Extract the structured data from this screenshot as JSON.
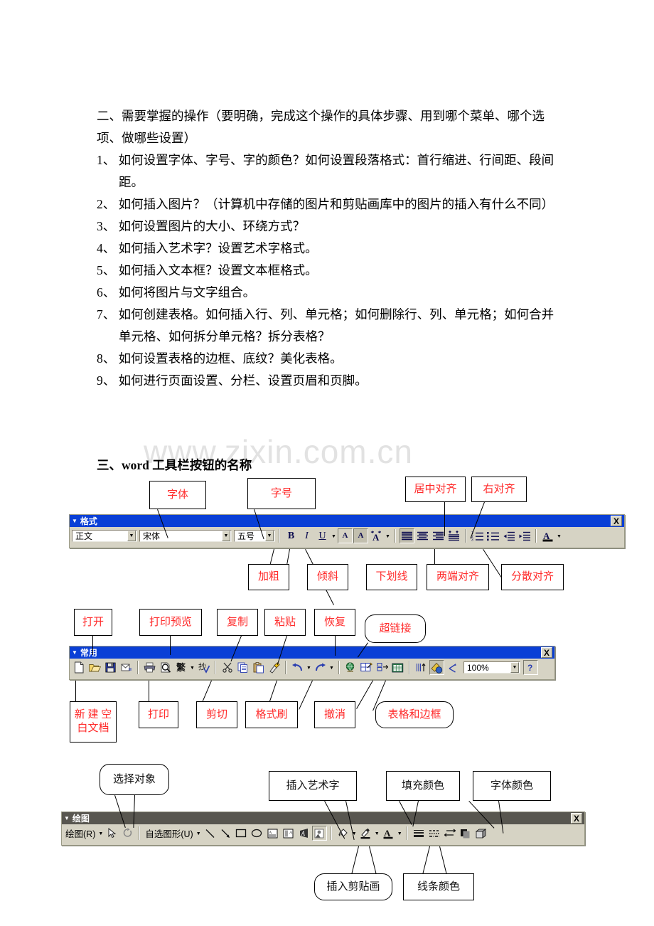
{
  "document": {
    "section_two_heading": "二、需要掌握的操作（要明确，完成这个操作的具体步骤、用到哪个菜单、哪个选项、做哪些设置）",
    "items": [
      "1、 如何设置字体、字号、字的颜色？如何设置段落格式：首行缩进、行间距、段间距。",
      "2、 如何插入图片？（计算机中存储的图片和剪贴画库中的图片的插入有什么不同）",
      "3、 如何设置图片的大小、环绕方式？",
      "4、 如何插入艺术字？设置艺术字格式。",
      "5、 如何插入文本框？设置文本框格式。",
      "6、 如何将图片与文字组合。",
      "7、 如何创建表格。如何插入行、列、单元格；如何删除行、列、单元格；如何合并单元格、如何拆分单元格？拆分表格？",
      "8、 如何设置表格的边框、底纹？美化表格。",
      "9、 如何进行页面设置、分栏、设置页眉和页脚。"
    ],
    "section_three_heading": "三、word 工具栏按钮的名称",
    "watermark": "www.zixin.com.cn"
  },
  "format_toolbar": {
    "title": "格式",
    "close_label": "X",
    "style_combo": "正文",
    "font_combo": "宋体",
    "size_combo": "五号",
    "buttons": [
      {
        "name": "bold",
        "glyph": "B"
      },
      {
        "name": "italic",
        "glyph": "I"
      },
      {
        "name": "underline",
        "glyph": "U"
      },
      {
        "name": "border-char",
        "glyph": "A"
      },
      {
        "name": "highlight-char",
        "glyph": "A"
      },
      {
        "name": "char-scaling",
        "glyph": "A"
      },
      {
        "name": "align-left"
      },
      {
        "name": "align-center"
      },
      {
        "name": "align-right"
      },
      {
        "name": "align-distributed"
      },
      {
        "name": "numbered-list"
      },
      {
        "name": "bulleted-list"
      },
      {
        "name": "decrease-indent"
      },
      {
        "name": "increase-indent"
      },
      {
        "name": "font-color",
        "glyph": "A"
      }
    ],
    "annotations": [
      {
        "id": "font-name",
        "label": "字体"
      },
      {
        "id": "font-size",
        "label": "字号"
      },
      {
        "id": "align-center",
        "label": "居中对齐"
      },
      {
        "id": "align-right",
        "label": "右对齐"
      },
      {
        "id": "bold",
        "label": "加粗"
      },
      {
        "id": "italic",
        "label": "倾斜"
      },
      {
        "id": "underline",
        "label": "下划线"
      },
      {
        "id": "justify",
        "label": "两端对齐"
      },
      {
        "id": "distributed",
        "label": "分散对齐"
      }
    ]
  },
  "standard_toolbar": {
    "title": "常用",
    "close_label": "X",
    "zoom_value": "100%",
    "annotations": [
      {
        "id": "open",
        "label": "打开"
      },
      {
        "id": "print-preview",
        "label": "打印预览"
      },
      {
        "id": "copy",
        "label": "复制"
      },
      {
        "id": "paste",
        "label": "粘贴"
      },
      {
        "id": "redo",
        "label": "恢复"
      },
      {
        "id": "hyperlink",
        "label": "超链接"
      },
      {
        "id": "new-blank-doc",
        "label": "新 建 空\n白文档"
      },
      {
        "id": "new-blank-doc-line1",
        "label": "新 建 空"
      },
      {
        "id": "new-blank-doc-line2",
        "label": "白文档"
      },
      {
        "id": "print",
        "label": "打印"
      },
      {
        "id": "cut",
        "label": "剪切"
      },
      {
        "id": "format-painter",
        "label": "格式刷"
      },
      {
        "id": "undo",
        "label": "撤消"
      },
      {
        "id": "tables-and-borders",
        "label": "表格和边框"
      }
    ]
  },
  "drawing_toolbar": {
    "title": "绘图",
    "close_label": "X",
    "draw_menu": "绘图(R)",
    "autoshapes_menu": "自选图形(U)",
    "annotations": [
      {
        "id": "select-objects",
        "label": "选择对象"
      },
      {
        "id": "insert-wordart",
        "label": "插入艺术字"
      },
      {
        "id": "fill-color",
        "label": "填充颜色"
      },
      {
        "id": "font-color",
        "label": "字体颜色"
      },
      {
        "id": "insert-clipart",
        "label": "插入剪贴画"
      },
      {
        "id": "line-color",
        "label": "线条颜色"
      }
    ]
  },
  "colors": {
    "annotation_red": "#ff2b2b",
    "titlebar_blue": "#0a3fd6",
    "titlebar_grey": "#58564f",
    "toolbar_face": "#d6d3c4",
    "watermark_grey": "#e2e2e2"
  }
}
